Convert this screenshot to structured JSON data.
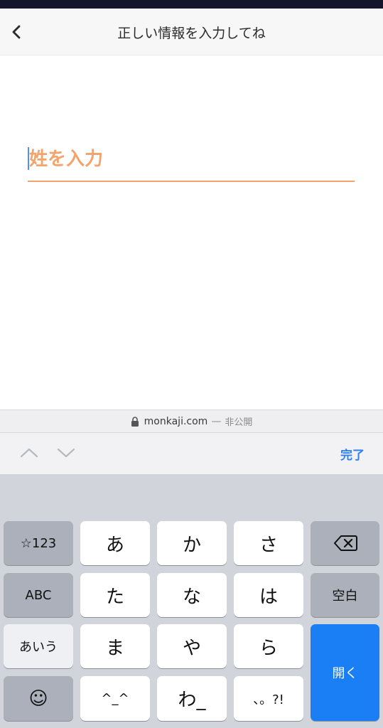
{
  "header": {
    "title": "正しい情報を入力してね"
  },
  "form": {
    "placeholder": "姓を入力",
    "value": ""
  },
  "url_bar": {
    "domain": "monkaji.com",
    "separator": "—",
    "visibility": "非公開"
  },
  "accessory": {
    "done_label": "完了"
  },
  "keyboard": {
    "mode_key": "☆123",
    "abc_key": "ABC",
    "kana_mode_key": "あいう",
    "emoji_key": "☺",
    "space_key": "空白",
    "return_key": "開く",
    "delete_icon": "delete-icon",
    "kana_keys": [
      "あ",
      "か",
      "さ",
      "た",
      "な",
      "は",
      "ま",
      "や",
      "ら",
      "^_^",
      "わ_",
      "、。?!"
    ]
  },
  "colors": {
    "accent": "#f2a46c",
    "link": "#2f7ff5",
    "return_key": "#1a7ff5",
    "keyboard_bg": "#d1d4da"
  }
}
